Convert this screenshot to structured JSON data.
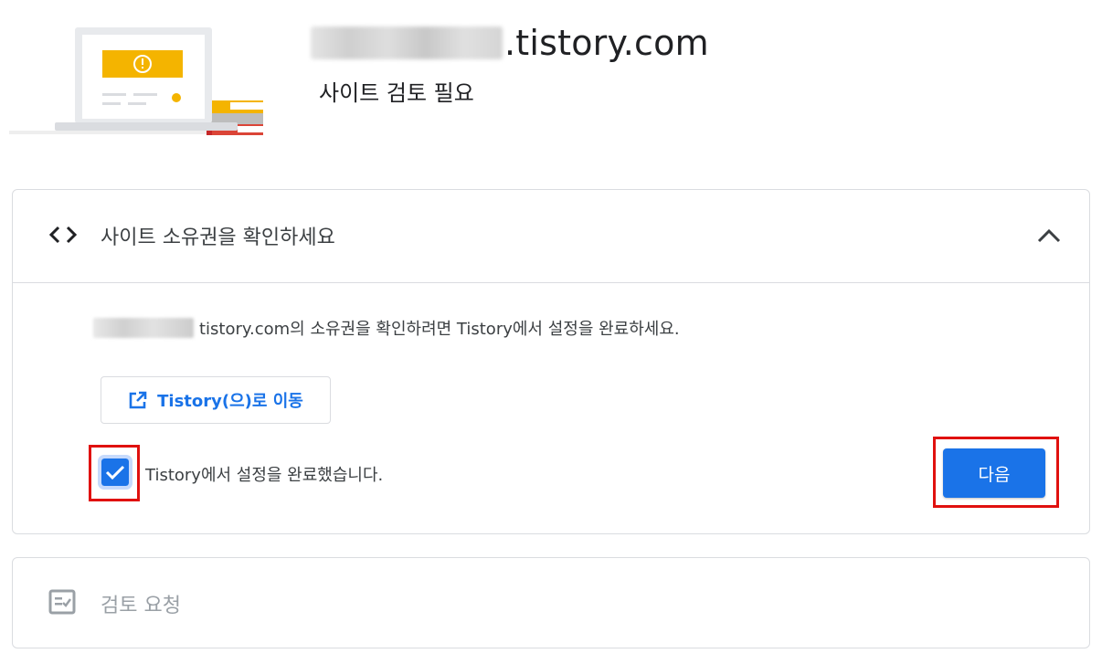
{
  "header": {
    "domain_suffix": ".tistory.com",
    "subtitle": "사이트 검토 필요"
  },
  "ownership_section": {
    "title": "사이트 소유권을 확인하세요",
    "description": "tistory.com의 소유권을 확인하려면 Tistory에서 설정을 완료하세요.",
    "goto_button_label": "Tistory(으)로 이동",
    "checkbox_label": "Tistory에서 설정을 완료했습니다.",
    "checkbox_checked": true,
    "next_button_label": "다음"
  },
  "review_section": {
    "title": "검토 요청"
  },
  "colors": {
    "primary": "#1a73e8",
    "highlight": "#e0110f",
    "illustration_yellow": "#f4b400",
    "illustration_red": "#db4437"
  }
}
